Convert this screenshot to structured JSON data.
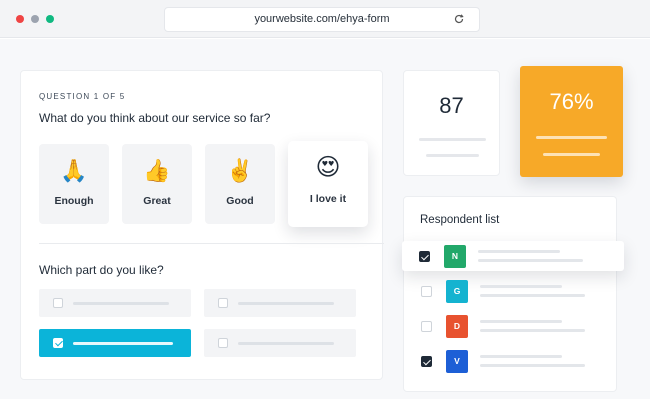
{
  "browser": {
    "url": "yourwebsite.com/ehya-form",
    "dots": [
      "#ef4444",
      "#9ca3af",
      "#10b981"
    ]
  },
  "form": {
    "question_counter": "QUESTION 1 OF 5",
    "question_title": "What do you think about our service so far?",
    "options": [
      {
        "emoji": "🙏",
        "label": "Enough",
        "icon": "praying-hands-icon"
      },
      {
        "emoji": "👍",
        "label": "Great",
        "icon": "thumbs-up-icon"
      },
      {
        "emoji": "✌️",
        "label": "Good",
        "icon": "victory-hand-icon"
      },
      {
        "emoji": "😍",
        "label": "I love it",
        "icon": "heart-eyes-icon"
      }
    ],
    "second_question": "Which part do you like?"
  },
  "stats": {
    "count": "87",
    "percent": "76%"
  },
  "respondents": {
    "title": "Respondent list",
    "items": [
      {
        "initial": "N",
        "color": "#22a86a",
        "checked": true
      },
      {
        "initial": "G",
        "color": "#14b3d0",
        "checked": false
      },
      {
        "initial": "D",
        "color": "#e8522f",
        "checked": false
      },
      {
        "initial": "V",
        "color": "#1d5fd6",
        "checked": true
      }
    ]
  },
  "colors": {
    "accent_orange": "#f7a928",
    "accent_cyan": "#0bb4d9"
  }
}
